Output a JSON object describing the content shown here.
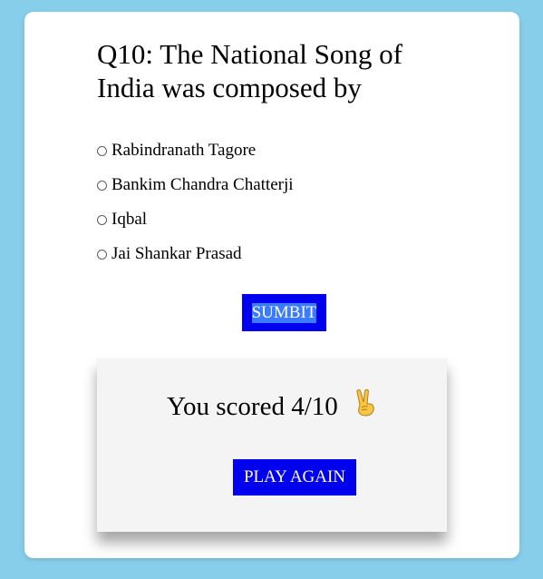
{
  "quiz": {
    "question": "Q10: The National Song of India was composed by",
    "options": [
      {
        "label": "Rabindranath Tagore"
      },
      {
        "label": "Bankim Chandra Chatterji"
      },
      {
        "label": "Iqbal"
      },
      {
        "label": "Jai Shankar Prasad"
      }
    ],
    "submit_label": "SUMBIT"
  },
  "result": {
    "score_text": "You scored 4/10",
    "icon": "victory-hand-icon",
    "play_again_label": "PLAY AGAIN"
  },
  "colors": {
    "page_background": "#87ceeb",
    "card_background": "#ffffff",
    "button_blue": "#0000ee",
    "result_background": "#f4f4f4"
  }
}
